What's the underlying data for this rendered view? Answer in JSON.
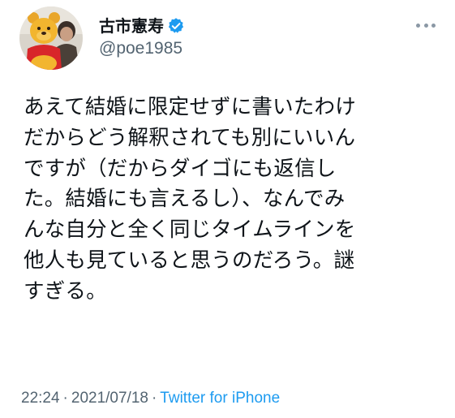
{
  "author": {
    "display_name": "古市憲寿",
    "handle": "@poe1985",
    "verified": true
  },
  "tweet": {
    "lines": [
      "あえて結婚に限定せずに書いたわけ",
      "だからどう解釈されても別にいいん",
      "ですが（だからダイゴにも返信し",
      "た。結婚にも言えるし）、なんでみ",
      "んな自分と全く同じタイムラインを",
      "他人も見ていると思うのだろう。謎",
      "すぎる。"
    ],
    "time": "22:24",
    "separator": "·",
    "date": "2021/07/18",
    "source": "Twitter for iPhone"
  },
  "colors": {
    "text": "#0f1419",
    "secondary": "#536471",
    "accent": "#1d9bf0"
  },
  "icons": {
    "verified": "verified-badge-icon",
    "more": "more-options-icon"
  }
}
